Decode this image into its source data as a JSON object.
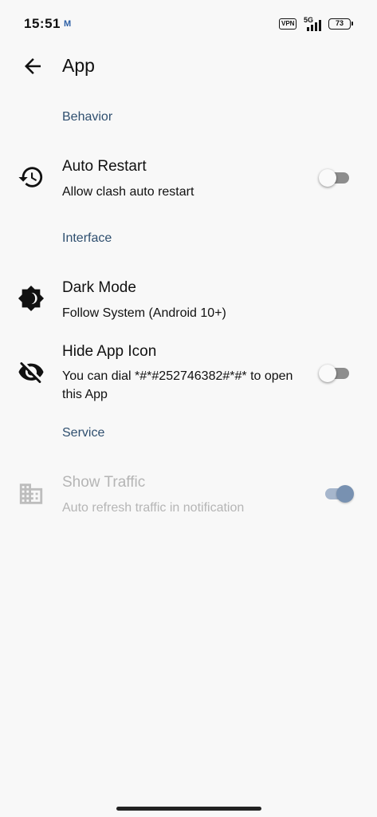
{
  "status_bar": {
    "time": "15:51",
    "mail_glyph": "M",
    "vpn": "VPN",
    "network": "5G",
    "battery": "73"
  },
  "app_bar": {
    "title": "App",
    "back_icon": "arrow-back-icon"
  },
  "sections": {
    "behavior": "Behavior",
    "interface": "Interface",
    "service": "Service"
  },
  "prefs": {
    "auto_restart": {
      "title": "Auto Restart",
      "summary": "Allow clash auto restart",
      "icon": "history-icon",
      "enabled": false
    },
    "dark_mode": {
      "title": "Dark Mode",
      "summary": "Follow System (Android 10+)",
      "icon": "brightness-icon"
    },
    "hide_app_icon": {
      "title": "Hide App Icon",
      "summary": "You can dial *#*#252746382#*#* to open this App",
      "icon": "visibility-off-icon",
      "enabled": false
    },
    "show_traffic": {
      "title": "Show Traffic",
      "summary": "Auto refresh traffic in notification",
      "icon": "domain-icon",
      "enabled": true,
      "disabled": true
    }
  },
  "colors": {
    "accent": "#7891b1",
    "section_header": "#2f4f6f",
    "disabled_text": "#b5b5b5"
  }
}
